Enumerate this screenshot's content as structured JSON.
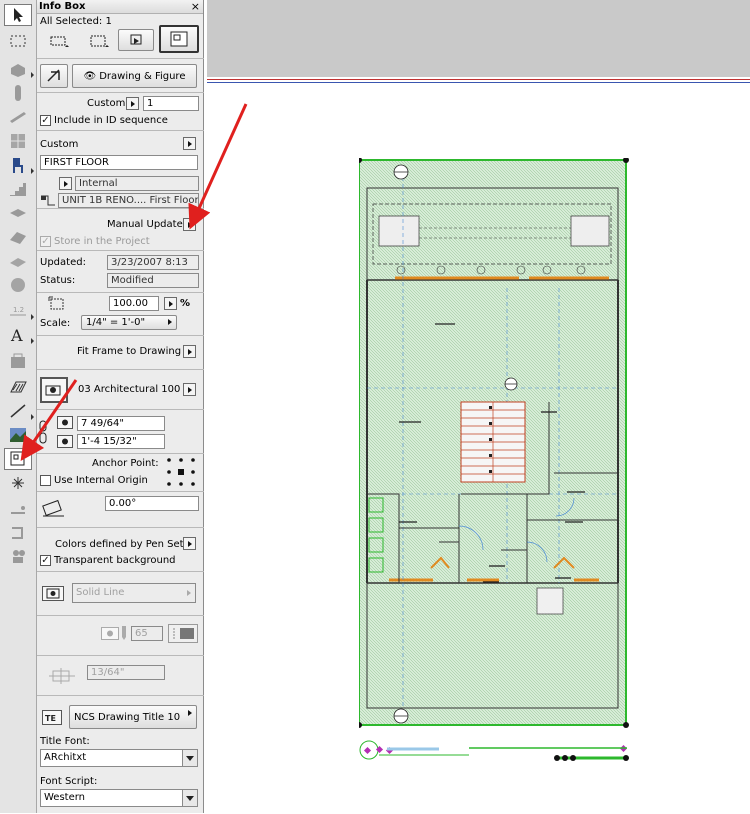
{
  "toolbox": {
    "tools": [
      {
        "name": "arrow-tool"
      },
      {
        "name": "marquee-tool"
      },
      {
        "name": "wall-tool"
      },
      {
        "name": "column-tool"
      },
      {
        "name": "beam-tool"
      },
      {
        "name": "window-tool"
      },
      {
        "name": "object-tool"
      },
      {
        "name": "stair-tool"
      },
      {
        "name": "slab-tool"
      },
      {
        "name": "roof-tool"
      },
      {
        "name": "mesh-tool"
      },
      {
        "name": "zone-tool"
      },
      {
        "name": "dimension-tool",
        "label": "1.2"
      },
      {
        "name": "text-tool",
        "label": "A"
      },
      {
        "name": "label-tool"
      },
      {
        "name": "fill-tool"
      },
      {
        "name": "line-tool"
      },
      {
        "name": "figure-tool"
      },
      {
        "name": "drawing-tool"
      },
      {
        "name": "hotspot-tool"
      },
      {
        "name": "section-tool"
      },
      {
        "name": "detail-tool"
      },
      {
        "name": "camera-tool"
      }
    ]
  },
  "infobox": {
    "title": "Info Box",
    "close": "×",
    "selected": "All Selected: 1",
    "display_button": "Drawing & Figure",
    "id_mode": "Custom",
    "id_value": "1",
    "include_id_label": "Include in ID sequence",
    "name_mode": "Custom",
    "name_value": "FIRST FLOOR",
    "source_type": "Internal",
    "source_view": "UNIT 1B RENO.... First Floor",
    "update_mode": "Manual Update",
    "store_label": "Store in the Project",
    "updated_label": "Updated:",
    "updated_value": "3/23/2007 8:13",
    "status_label": "Status:",
    "status_value": "Modified",
    "scale_percent": "100.00",
    "percent_sign": "%",
    "scale_label": "Scale:",
    "scale_value": "1/4\"  =  1'-0\"",
    "fit_frame_label": "Fit Frame to Drawing",
    "layer_value": "03 Architectural 100",
    "width_value": "7 49/64\"",
    "height_value": "1'-4 15/32\"",
    "anchor_label": "Anchor Point:",
    "internal_origin_label": "Use Internal Origin",
    "angle_value": "0.00°",
    "colors_label": "Colors defined by Pen Set",
    "transparent_label": "Transparent background",
    "line_type": "Solid Line",
    "pen_value": "65",
    "frame_offset": "13/64\"",
    "title_type": "NCS Drawing Title 10",
    "title_font_label": "Title Font:",
    "title_font_value": "ARchitxt",
    "font_script_label": "Font Script:",
    "font_script_value": "Western"
  },
  "colors": {
    "accent_arrow": "#e0201e",
    "plan_green": "#2db82d",
    "plan_fill": "#cfe8cf",
    "canvas_grey": "#c9c9c9"
  }
}
